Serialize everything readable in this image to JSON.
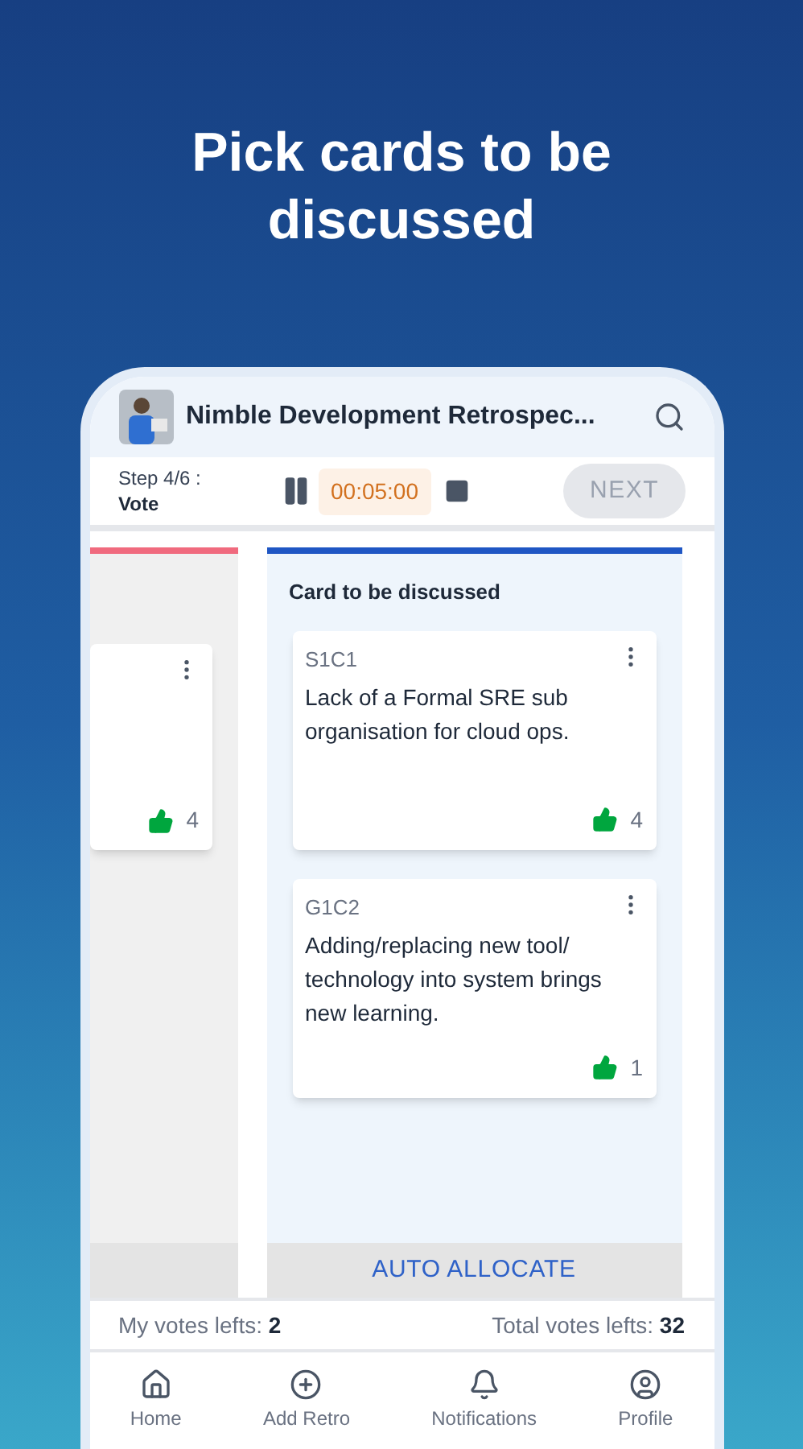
{
  "headline": "Pick cards to be discussed",
  "app_bar": {
    "title": "Nimble Development Retrospec..."
  },
  "step": {
    "label": "Step 4/6 :",
    "name": "Vote",
    "timer": "00:05:00",
    "next": {
      "label": "NEXT",
      "disabled": true
    }
  },
  "columns": [
    {
      "color": "#f06a7e",
      "cards": [
        {
          "votes": "4"
        }
      ]
    },
    {
      "color": "#1f56c4",
      "title": "Card to be discussed",
      "action": "AUTO ALLOCATE",
      "cards": [
        {
          "code": "S1C1",
          "text": "Lack of a Formal SRE sub organisation for cloud ops.",
          "votes": "4"
        },
        {
          "code": "G1C2",
          "text": "Adding/replacing new tool/ technology into system brings new learning.",
          "votes": "1"
        }
      ]
    }
  ],
  "votes": {
    "mine_label": "My votes lefts:",
    "mine": "2",
    "total_label": "Total votes lefts:",
    "total": "32"
  },
  "nav": [
    {
      "kind": "home",
      "label": "Home"
    },
    {
      "kind": "add",
      "label": "Add Retro"
    },
    {
      "kind": "bell",
      "label": "Notifications"
    },
    {
      "kind": "profile",
      "label": "Profile"
    }
  ]
}
